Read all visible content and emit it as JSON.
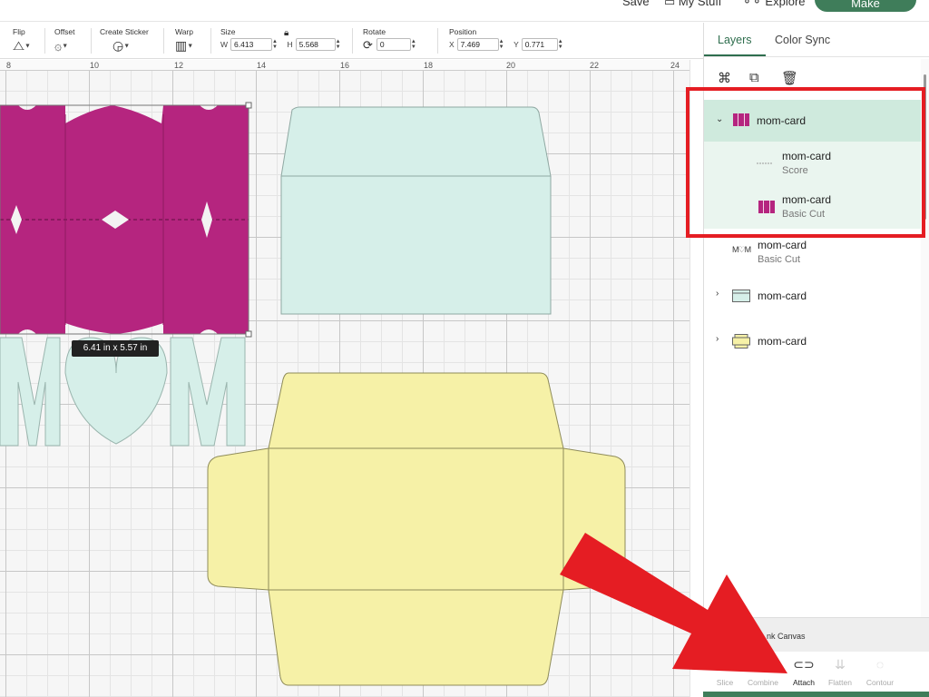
{
  "header": {
    "save_label": "Save",
    "mystuff_label": "My Stuff",
    "explore_label": "Explore",
    "make_label": "Make"
  },
  "toolbar": {
    "flip_label": "Flip",
    "offset_label": "Offset",
    "sticker_label": "Create Sticker",
    "warp_label": "Warp",
    "size_label": "Size",
    "w_label": "W",
    "w_value": "6.413",
    "h_label": "H",
    "h_value": "5.568",
    "rotate_label": "Rotate",
    "rotate_value": "0",
    "position_label": "Position",
    "x_label": "X",
    "x_value": "7.469",
    "y_label": "Y",
    "y_value": "0.771"
  },
  "ruler": {
    "ticks": [
      "8",
      "10",
      "12",
      "14",
      "16",
      "18",
      "20",
      "22",
      "24"
    ]
  },
  "canvas": {
    "dimension_tooltip": "6.41  in x 5.57  in",
    "colors": {
      "magenta": "#b5257f",
      "mint": "#d6efe9",
      "yellow": "#f6f1a7"
    }
  },
  "panel": {
    "tabs": {
      "layers": "Layers",
      "color_sync": "Color Sync"
    },
    "layers": [
      {
        "name": "mom-card",
        "sub": ""
      },
      {
        "name": "mom-card",
        "sub": "Score"
      },
      {
        "name": "mom-card",
        "sub": "Basic Cut"
      },
      {
        "name": "mom-card",
        "sub": "Basic Cut"
      },
      {
        "name": "mom-card",
        "sub": ""
      },
      {
        "name": "mom-card",
        "sub": ""
      }
    ],
    "blank_canvas_label": "nk Canvas"
  },
  "bottom_tools": {
    "slice": "Slice",
    "combine": "Combine",
    "attach": "Attach",
    "flatten": "Flatten",
    "contour": "Contour"
  },
  "annotation_colors": {
    "red": "#e51d23"
  }
}
